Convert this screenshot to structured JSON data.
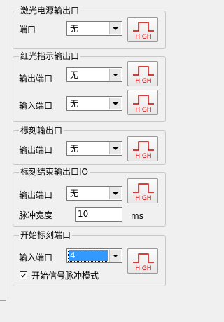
{
  "laser_output": {
    "title": "激光电源输出口",
    "port_label": "端口",
    "port_value": "无"
  },
  "red_light": {
    "title": "红光指示输出口",
    "output_label": "输出端口",
    "output_value": "无",
    "input_label": "输入端口",
    "input_value": "无"
  },
  "mark_output": {
    "title": "标刻输出口",
    "output_label": "输出端口",
    "output_value": "无"
  },
  "mark_end": {
    "title": "标刻结束输出口IO",
    "output_label": "输出端口",
    "output_value": "无",
    "pulse_label": "脉冲宽度",
    "pulse_value": "10",
    "pulse_unit": "ms"
  },
  "start_mark": {
    "title": "开始标刻端口",
    "input_label": "输入端口",
    "input_value": "4",
    "pulse_mode_label": "开始信号脉冲模式",
    "pulse_mode_checked": true
  },
  "high_button_text": "HIGH",
  "colors": {
    "high_red": "#cc0000",
    "selection": "#3399ff"
  }
}
